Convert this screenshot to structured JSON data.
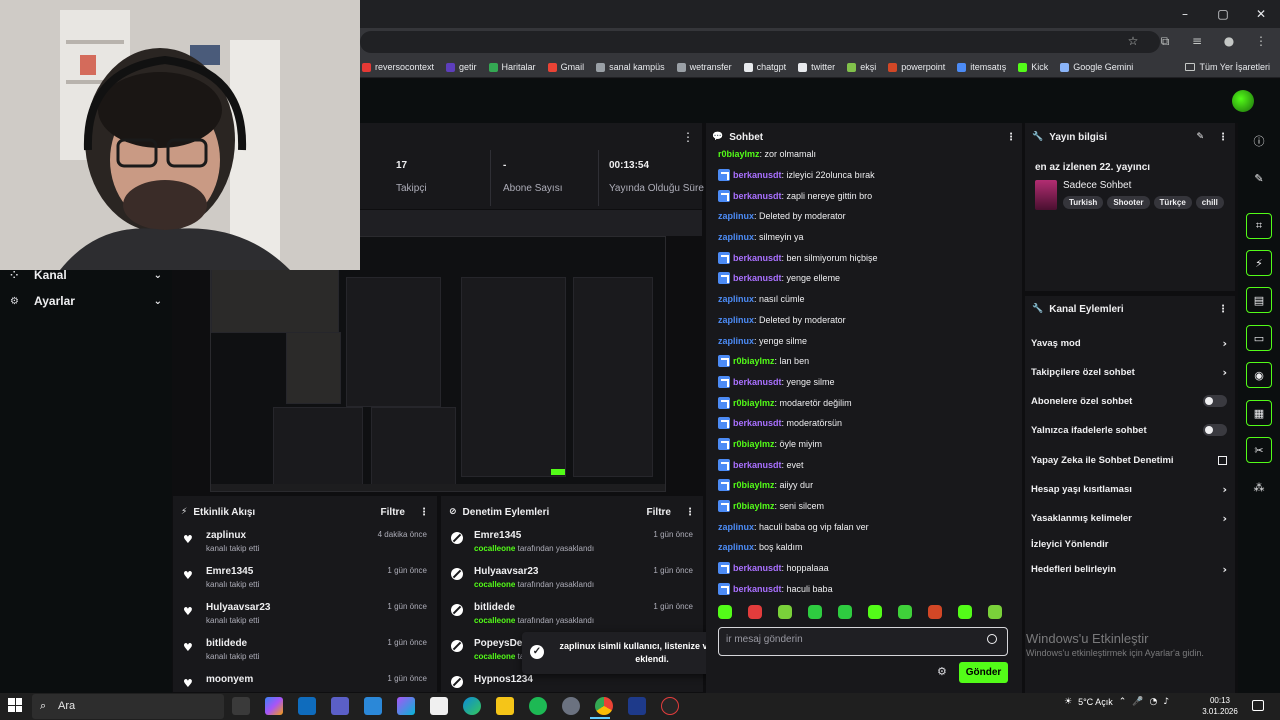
{
  "browser": {
    "window_controls": {
      "minimize": "–",
      "maximize": "▢",
      "close": "✕"
    },
    "bookmarks": [
      {
        "label": "reversocontext",
        "color": "#e53935"
      },
      {
        "label": "getir",
        "color": "#5d3ebc"
      },
      {
        "label": "Haritalar",
        "color": "#34a853"
      },
      {
        "label": "Gmail",
        "color": "#ea4335"
      },
      {
        "label": "sanal kampüs",
        "color": "#9aa0a6"
      },
      {
        "label": "wetransfer",
        "color": "#9aa0a6"
      },
      {
        "label": "chatgpt",
        "color": "#e8eaed"
      },
      {
        "label": "twitter",
        "color": "#e8eaed"
      },
      {
        "label": "ekşi",
        "color": "#81c14b"
      },
      {
        "label": "powerpoint",
        "color": "#d24726"
      },
      {
        "label": "itemsatış",
        "color": "#4c8bf5"
      },
      {
        "label": "Kick",
        "color": "#53fc18"
      },
      {
        "label": "Google Gemini",
        "color": "#8ab4f8"
      }
    ],
    "all_bookmarks": "Tüm Yer İşaretleri"
  },
  "nav": {
    "items": [
      {
        "label": "Kanal",
        "icon": "channel-icon"
      },
      {
        "label": "Ayarlar",
        "icon": "gear-icon"
      }
    ]
  },
  "stats": {
    "items": [
      {
        "value": "17",
        "label": "Takipçi"
      },
      {
        "value": "-",
        "label": "Abone Sayısı"
      },
      {
        "value": "00:13:54",
        "label": "Yayında Olduğu Süre"
      }
    ]
  },
  "events": {
    "title": "Etkinlik Akışı",
    "filter": "Filtre",
    "items": [
      {
        "name": "zaplinux",
        "time": "4 dakika önce",
        "desc": "kanalı takip etti"
      },
      {
        "name": "Emre1345",
        "time": "1 gün önce",
        "desc": "kanalı takip etti"
      },
      {
        "name": "Hulyaavsar23",
        "time": "1 gün önce",
        "desc": "kanalı takip etti"
      },
      {
        "name": "bitlidede",
        "time": "1 gün önce",
        "desc": "kanalı takip etti"
      },
      {
        "name": "moonyem",
        "time": "1 gün önce",
        "desc": ""
      }
    ]
  },
  "mod": {
    "title": "Denetim Eylemleri",
    "filter": "Filtre",
    "by_suffix": "tarafından yasaklandı",
    "items": [
      {
        "name": "Emre1345",
        "time": "1 gün önce",
        "by": "cocalleone"
      },
      {
        "name": "Hulyaavsar23",
        "time": "1 gün önce",
        "by": "cocalleone"
      },
      {
        "name": "bitlidede",
        "time": "1 gün önce",
        "by": "cocalleone"
      },
      {
        "name": "PopeysDeli",
        "time": "",
        "by": "cocalleone"
      },
      {
        "name": "Hypnos1234",
        "time": "",
        "by": ""
      }
    ]
  },
  "toast": {
    "text": "zaplinux isimli kullanıcı, listenize vip olarak eklendi."
  },
  "chat": {
    "title": "Sohbet",
    "messages": [
      {
        "user": "r0biaylmz",
        "text": "zor olmamalı",
        "badge": false,
        "color": "#53fc18"
      },
      {
        "user": "berkanusdt",
        "text": "izleyici 22olunca bırak",
        "badge": true,
        "color": "#a970ff"
      },
      {
        "user": "berkanusdt",
        "text": "zapli nereye gittin bro",
        "badge": true,
        "color": "#a970ff"
      },
      {
        "user": "zaplinux",
        "text": "Deleted by moderator",
        "badge": false,
        "color": "#4c8bf5"
      },
      {
        "user": "zaplinux",
        "text": "silmeyin ya",
        "badge": false,
        "color": "#4c8bf5"
      },
      {
        "user": "berkanusdt",
        "text": "ben silmiyorum hiçbişe",
        "badge": true,
        "color": "#a970ff"
      },
      {
        "user": "berkanusdt",
        "text": "yenge elleme",
        "badge": true,
        "color": "#a970ff"
      },
      {
        "user": "zaplinux",
        "text": "nasıl cümle",
        "badge": false,
        "color": "#4c8bf5"
      },
      {
        "user": "zaplinux",
        "text": "Deleted by moderator",
        "badge": false,
        "color": "#4c8bf5"
      },
      {
        "user": "zaplinux",
        "text": "yenge silme",
        "badge": false,
        "color": "#4c8bf5"
      },
      {
        "user": "r0biaylmz",
        "text": "lan ben",
        "badge": true,
        "color": "#53fc18"
      },
      {
        "user": "berkanusdt",
        "text": "yenge silme",
        "badge": true,
        "color": "#a970ff"
      },
      {
        "user": "r0biaylmz",
        "text": "modaretör değilim",
        "badge": true,
        "color": "#53fc18"
      },
      {
        "user": "berkanusdt",
        "text": "moderatörsün",
        "badge": true,
        "color": "#a970ff"
      },
      {
        "user": "r0biaylmz",
        "text": "öyle miyim",
        "badge": true,
        "color": "#53fc18"
      },
      {
        "user": "berkanusdt",
        "text": "evet",
        "badge": true,
        "color": "#a970ff"
      },
      {
        "user": "r0biaylmz",
        "text": "aiiyy dur",
        "badge": true,
        "color": "#53fc18"
      },
      {
        "user": "r0biaylmz",
        "text": "seni silcem",
        "badge": true,
        "color": "#53fc18"
      },
      {
        "user": "zaplinux",
        "text": "haculi baba og vip falan ver",
        "badge": false,
        "color": "#4c8bf5"
      },
      {
        "user": "zaplinux",
        "text": "boş kaldım",
        "badge": false,
        "color": "#4c8bf5"
      },
      {
        "user": "berkanusdt",
        "text": "hoppalaaa",
        "badge": true,
        "color": "#a970ff"
      },
      {
        "user": "berkanusdt",
        "text": "haculi baba",
        "badge": true,
        "color": "#a970ff"
      }
    ],
    "input_placeholder": "ir mesaj gönderin",
    "send_label": "Gönder",
    "emote_colors": [
      "#53fc18",
      "#e23c3c",
      "#7ad13a",
      "#2ecc40",
      "#2ecc40",
      "#53fc18",
      "#3fd13a",
      "#d24726",
      "#53fc18",
      "#7ad13a"
    ]
  },
  "stream_info": {
    "title": "Yayın bilgisi",
    "stream_title": "en az izlenen 22. yayıncı",
    "category": "Sadece Sohbet",
    "tags": [
      "Turkish",
      "Shooter",
      "Türkçe",
      "chill"
    ]
  },
  "channel_actions": {
    "title": "Kanal Eylemleri",
    "items": [
      {
        "label": "Yavaş mod",
        "control": "chevron"
      },
      {
        "label": "Takipçilere özel sohbet",
        "control": "chevron"
      },
      {
        "label": "Abonelere özel sohbet",
        "control": "toggle"
      },
      {
        "label": "Yalnızca ifadelerle sohbet",
        "control": "toggle"
      },
      {
        "label": "Yapay Zeka ile Sohbet Denetimi",
        "control": "external"
      },
      {
        "label": "Hesap yaşı kısıtlaması",
        "control": "chevron"
      },
      {
        "label": "Yasaklanmış kelimeler",
        "control": "chevron"
      },
      {
        "label": "İzleyici Yönlendir",
        "control": "none"
      },
      {
        "label": "Hedefleri belirleyin",
        "control": "chevron"
      }
    ]
  },
  "watermark": {
    "title": "Windows'u Etkinleştir",
    "subtitle": "Windows'u etkinleştirmek için Ayarlar'a gidin."
  },
  "taskbar": {
    "search_placeholder": "Ara",
    "weather": "5°C  Açık",
    "time": "00:13",
    "date": "3.01.2026"
  }
}
